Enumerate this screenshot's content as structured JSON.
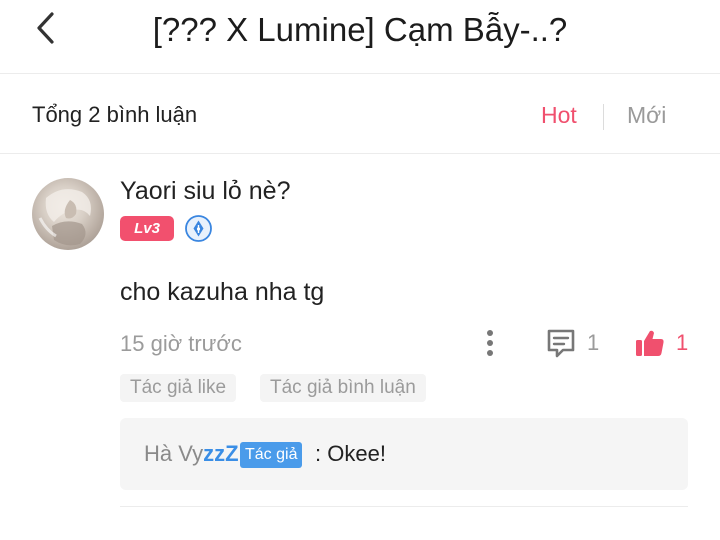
{
  "header": {
    "back_icon": "chevron-left-icon",
    "title": "[??? X Lumine] Cạm Bẫy-..?"
  },
  "comments_bar": {
    "total": "Tổng 2 bình luận",
    "sort_hot": "Hot",
    "sort_new": "Mới",
    "active_sort_color": "#f0506e"
  },
  "comment": {
    "username": "Yaori siu lỏ nè?",
    "level": "Lv3",
    "role_icon": "pen-nib-icon",
    "content": "cho kazuha nha tg",
    "time": "15 giờ trước",
    "reply_count": "1",
    "like_count": "1",
    "tags": [
      "Tác giả like",
      "Tác giả bình luận"
    ],
    "reply": {
      "author_name": "Hà Vy",
      "author_suffix": "zzZ",
      "author_badge": "Tác giả",
      "separator": ":",
      "text": "Okee!"
    }
  },
  "colors": {
    "accent": "#f0506e",
    "level_badge": "#f2506e",
    "author_badge": "#4a9bea"
  }
}
